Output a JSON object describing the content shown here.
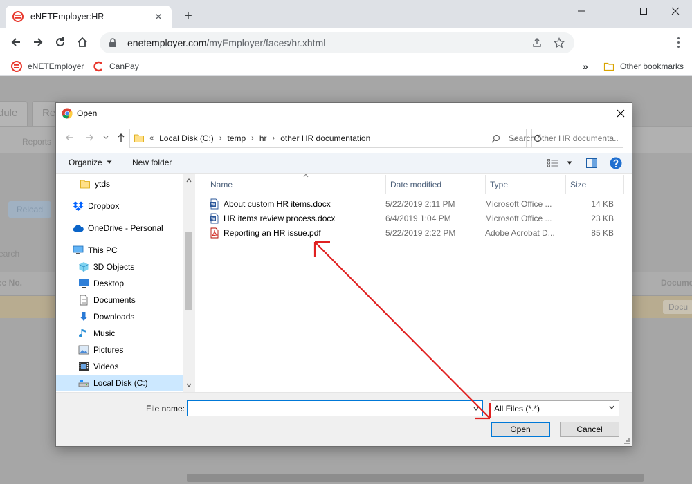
{
  "browser": {
    "tab_title": "eNETEmployer:HR",
    "url_domain": "enetemployer.com",
    "url_path": "/myEmployer/faces/hr.xhtml",
    "bookmarks": [
      "eNETEmployer",
      "CanPay"
    ],
    "bookmarks_overflow": "»",
    "other_bookmarks": "Other bookmarks"
  },
  "background_page": {
    "tab_fragments": [
      "dule",
      "Re"
    ],
    "reports_label": "Reports",
    "reload_label": "Reload",
    "search_fragment": "earch",
    "col_employee_fragment": "ee No.",
    "col_document_fragment": "Docume",
    "doc_button_fragment": "Docu"
  },
  "dialog": {
    "title": "Open",
    "breadcrumb": [
      "Local Disk (C:)",
      "temp",
      "hr",
      "other HR documentation"
    ],
    "breadcrumb_overflow": "«",
    "search_placeholder": "Search other HR documenta...",
    "organize_label": "Organize",
    "new_folder_label": "New folder",
    "nav_items": [
      {
        "label": "ytds",
        "icon": "folder-icon"
      },
      {
        "label": "Dropbox",
        "icon": "dropbox-icon"
      },
      {
        "label": "OneDrive - Personal",
        "icon": "onedrive-icon"
      },
      {
        "label": "This PC",
        "icon": "computer-icon"
      },
      {
        "label": "3D Objects",
        "icon": "cube-icon"
      },
      {
        "label": "Desktop",
        "icon": "desktop-icon"
      },
      {
        "label": "Documents",
        "icon": "documents-icon"
      },
      {
        "label": "Downloads",
        "icon": "download-icon"
      },
      {
        "label": "Music",
        "icon": "music-icon"
      },
      {
        "label": "Pictures",
        "icon": "pictures-icon"
      },
      {
        "label": "Videos",
        "icon": "videos-icon"
      },
      {
        "label": "Local Disk (C:)",
        "icon": "drive-icon"
      }
    ],
    "selected_nav": "Local Disk (C:)",
    "columns": [
      "Name",
      "Date modified",
      "Type",
      "Size"
    ],
    "files": [
      {
        "name": "About custom HR items.docx",
        "date": "5/22/2019 2:11 PM",
        "type": "Microsoft Office ...",
        "size": "14 KB",
        "icon": "word-doc-icon"
      },
      {
        "name": "HR items review process.docx",
        "date": "6/4/2019 1:04 PM",
        "type": "Microsoft Office ...",
        "size": "23 KB",
        "icon": "word-doc-icon"
      },
      {
        "name": "Reporting an HR issue.pdf",
        "date": "5/22/2019 2:22 PM",
        "type": "Adobe Acrobat D...",
        "size": "85 KB",
        "icon": "pdf-icon"
      }
    ],
    "file_name_label": "File name:",
    "file_name_value": "",
    "filter_value": "All Files (*.*)",
    "open_label": "Open",
    "cancel_label": "Cancel"
  },
  "colors": {
    "accent": "#0078d7",
    "annotation_arrow": "#e02020",
    "selection": "#cce8ff",
    "brand_red": "#e8352a"
  }
}
